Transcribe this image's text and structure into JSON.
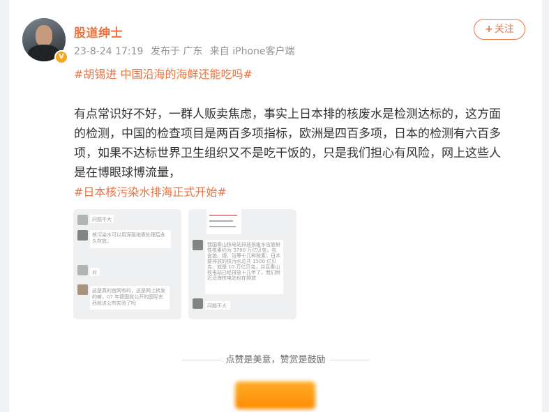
{
  "post": {
    "author": "股道绅士",
    "timestamp": "23-8-24 17:19",
    "location": "发布于 广东",
    "source": "来自 iPhone客户端",
    "follow_label": "关注",
    "topic_1": "#胡锡进 中国沿海的海鲜还能吃吗#",
    "body_lines": [
      "有点常识好不好，一群人贩卖焦虑，事实上日本排的核废水是检测达标的，这方面",
      "的检测，中国的检查项目是两百多项指标，欧洲是四百多项，日本的检测有六百多",
      "项，如果不达标世界卫生组织又不是吃干饭的，只是我们担心有风险，网上这些人",
      "是在博眼球博流量，"
    ],
    "topic_2": "#日本核污染水排海正式开始#"
  },
  "images": [
    {
      "messages": [
        "问题不大",
        "核污染水可以用深层地质处理后永久存放。",
        "对",
        "这是真的官网有的，这是网上转发的嘛，07 年德国就公开的国际东西就该公布实验了吗"
      ]
    },
    {
      "messages": [
        "我国秦山核电站排放核废水含放射性核素约为 3780 万亿贝克，包含铯、锶、氚等十几种核素；日本要排放的核污水总共 1500 亿贝克，就是 10 万亿贝克，并且秦山核电站已经排放十几年了，我们附近沿海核电站也在排放",
        "问题不大"
      ]
    }
  ],
  "reward": {
    "text": "点赞是美意，赞赏是鼓励"
  },
  "colors": {
    "accent": "#eb7340",
    "badge": "#f5a623",
    "reward_button": "#ff9a14"
  }
}
